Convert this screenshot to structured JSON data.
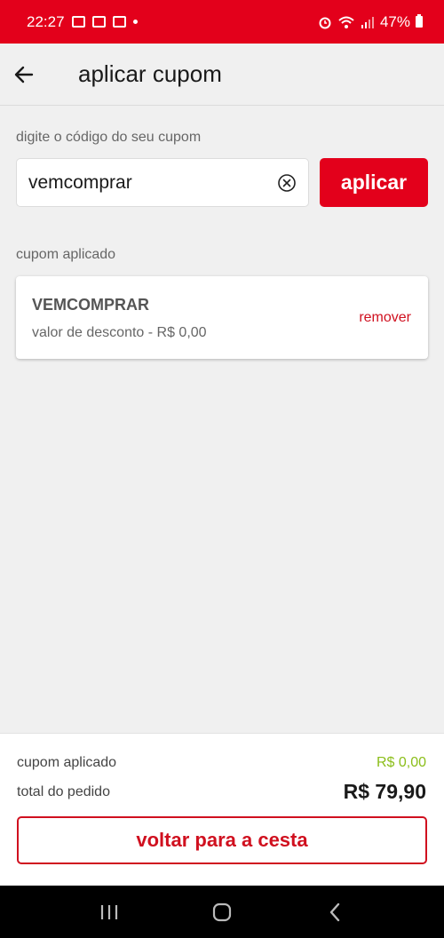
{
  "status_bar": {
    "time": "22:27",
    "battery": "47%"
  },
  "header": {
    "title": "aplicar cupom"
  },
  "coupon_form": {
    "label": "digite o código do seu cupom",
    "value": "vemcomprar",
    "apply_label": "aplicar"
  },
  "applied": {
    "section_label": "cupom aplicado",
    "code": "VEMCOMPRAR",
    "discount_text": "valor de desconto - R$ 0,00",
    "remove_label": "remover"
  },
  "summary": {
    "coupon_label": "cupom aplicado",
    "coupon_value": "R$ 0,00",
    "total_label": "total do pedido",
    "total_value": "R$ 79,90",
    "back_button": "voltar para a cesta"
  },
  "colors": {
    "brand": "#e3001b",
    "discount": "#8bbe1a"
  },
  "icons": {
    "back": "arrow-left-icon",
    "clear": "clear-circle-icon",
    "nav_recents": "recents-icon",
    "nav_home": "home-icon",
    "nav_back": "chevron-left-icon"
  }
}
